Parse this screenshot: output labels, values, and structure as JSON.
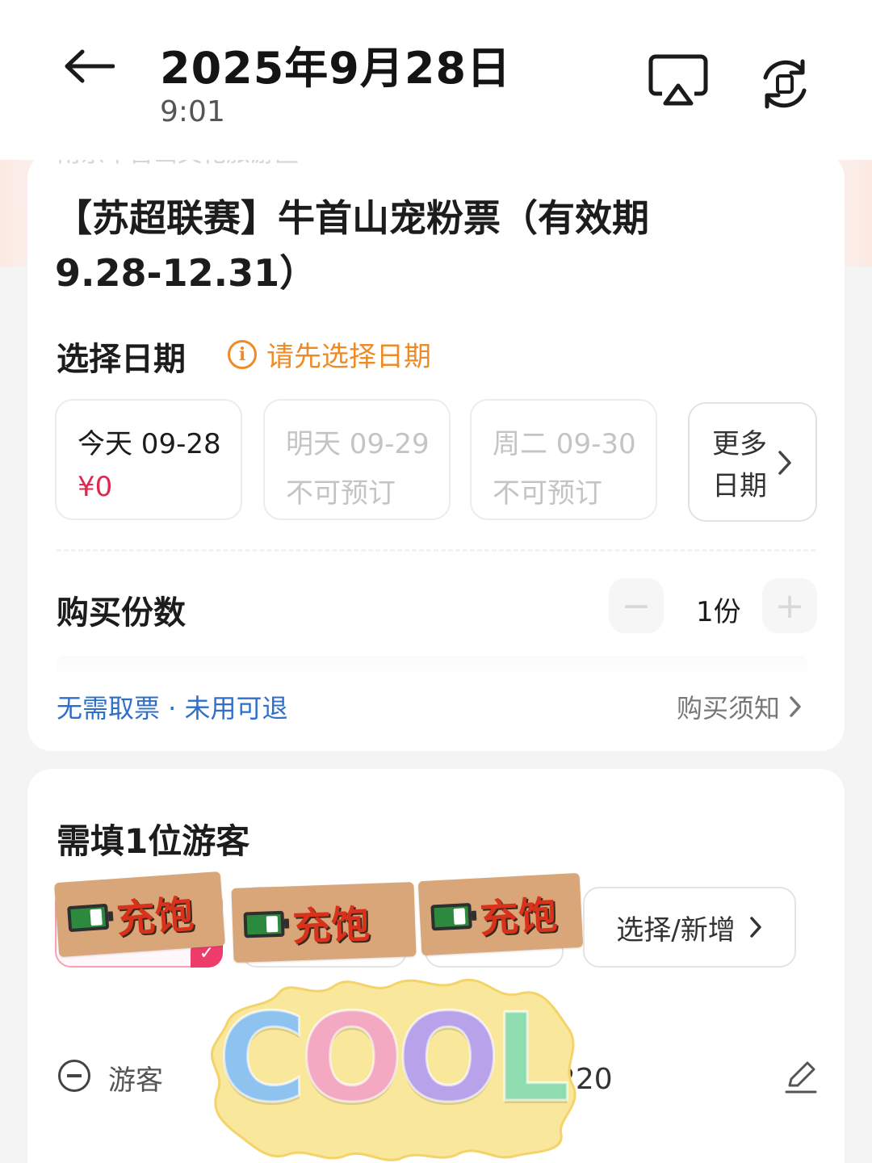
{
  "header": {
    "date": "2025年9月28日",
    "time": "9:01",
    "ghost_text": "南京牛首山文化旅游区"
  },
  "ticket": {
    "title_line1": "【苏超联赛】牛首山宠粉票（有效期",
    "title_line2": "9.28-12.31）"
  },
  "date_section": {
    "label": "选择日期",
    "hint": "请先选择日期",
    "options": [
      {
        "day": "今天 09-28",
        "status": "¥0",
        "available": true
      },
      {
        "day": "明天 09-29",
        "status": "不可预订",
        "available": false
      },
      {
        "day": "周二 09-30",
        "status": "不可预订",
        "available": false
      }
    ],
    "more_line1": "更多",
    "more_line2": "日期"
  },
  "quantity": {
    "label": "购买份数",
    "value": "1份",
    "minus": "−",
    "plus": "+"
  },
  "policy": {
    "refund": "无需取票 · 未用可退",
    "notice": "购买须知"
  },
  "guests": {
    "need": "需填1位游客",
    "sticker_text": "充饱",
    "select_add": "选择/新增",
    "row_label": "游客",
    "row_id_partial": "220"
  },
  "cool_sticker": {
    "letters": [
      "C",
      "O",
      "O",
      "L"
    ],
    "colors": [
      "#8fc3ef",
      "#f3a9c2",
      "#b8a2ea",
      "#8edcb0"
    ],
    "blob_color": "#f9e79b"
  },
  "colors": {
    "accent_orange": "#f08a24",
    "price_red": "#e0284f",
    "link_blue": "#2f6fcb"
  }
}
